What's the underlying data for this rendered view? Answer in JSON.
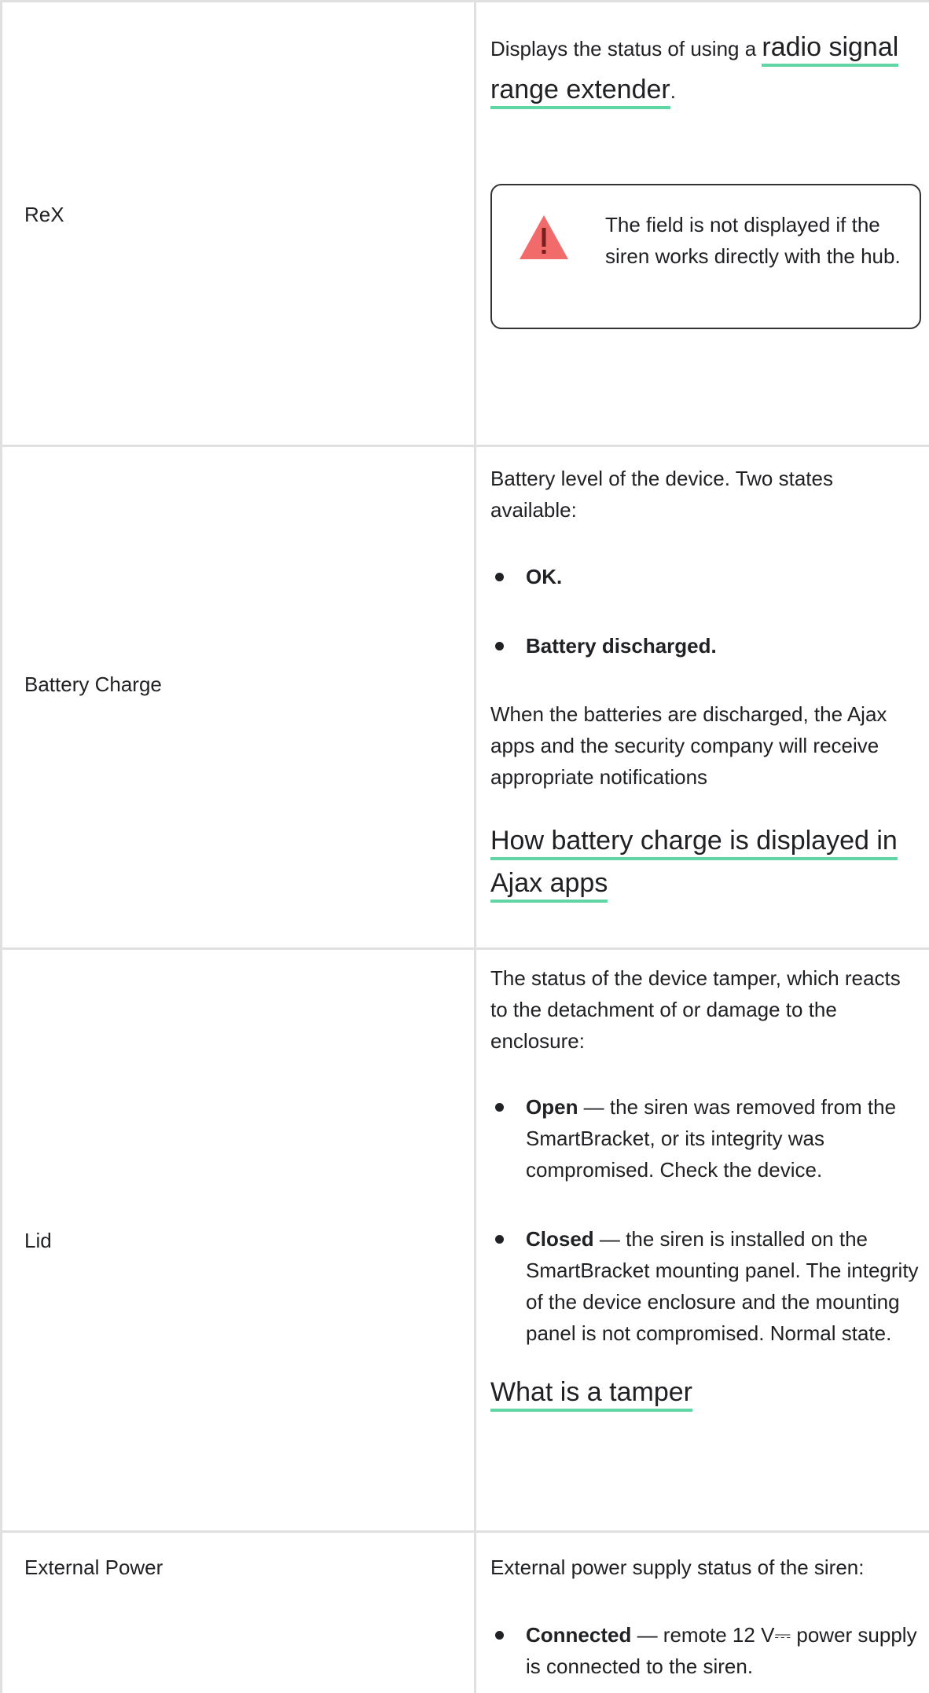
{
  "rows": [
    {
      "name": "ReX",
      "desc_prefix": "Displays the status of using a ",
      "link": "radio signal range extender",
      "desc_suffix": ".",
      "warning": "The field is not displayed if the siren works directly with the hub."
    },
    {
      "name": "Battery Charge",
      "intro": "Battery level of the device. Two states available:",
      "items": [
        "OK.",
        "Battery discharged."
      ],
      "note": "When the batteries are discharged, the Ajax apps and the security company will receive appropriate notifications",
      "link": "How battery charge is displayed in Ajax apps"
    },
    {
      "name": "Lid",
      "intro": "The status of the device tamper, which reacts to the detachment of or damage to the enclosure:",
      "items": [
        {
          "term": "Open",
          "text": " — the siren was removed from the SmartBracket, or its integrity was compromised. Check the device."
        },
        {
          "term": "Closed",
          "text": " — the siren is installed on the SmartBracket mounting panel. The integrity of the device enclosure and the mounting panel is not compromised. Normal state."
        }
      ],
      "link": "What is a tamper"
    },
    {
      "name": "External Power",
      "intro": "External power supply status of the siren:",
      "items": [
        {
          "term": "Connected",
          "text": " — remote 12 V⎓ power supply is connected to the siren."
        }
      ]
    }
  ],
  "icons": {
    "warning": "warning-triangle-icon"
  },
  "colors": {
    "link_underline": "#5fd6a4",
    "warning_icon": "#f26b6b",
    "border": "#e0e0e0"
  }
}
